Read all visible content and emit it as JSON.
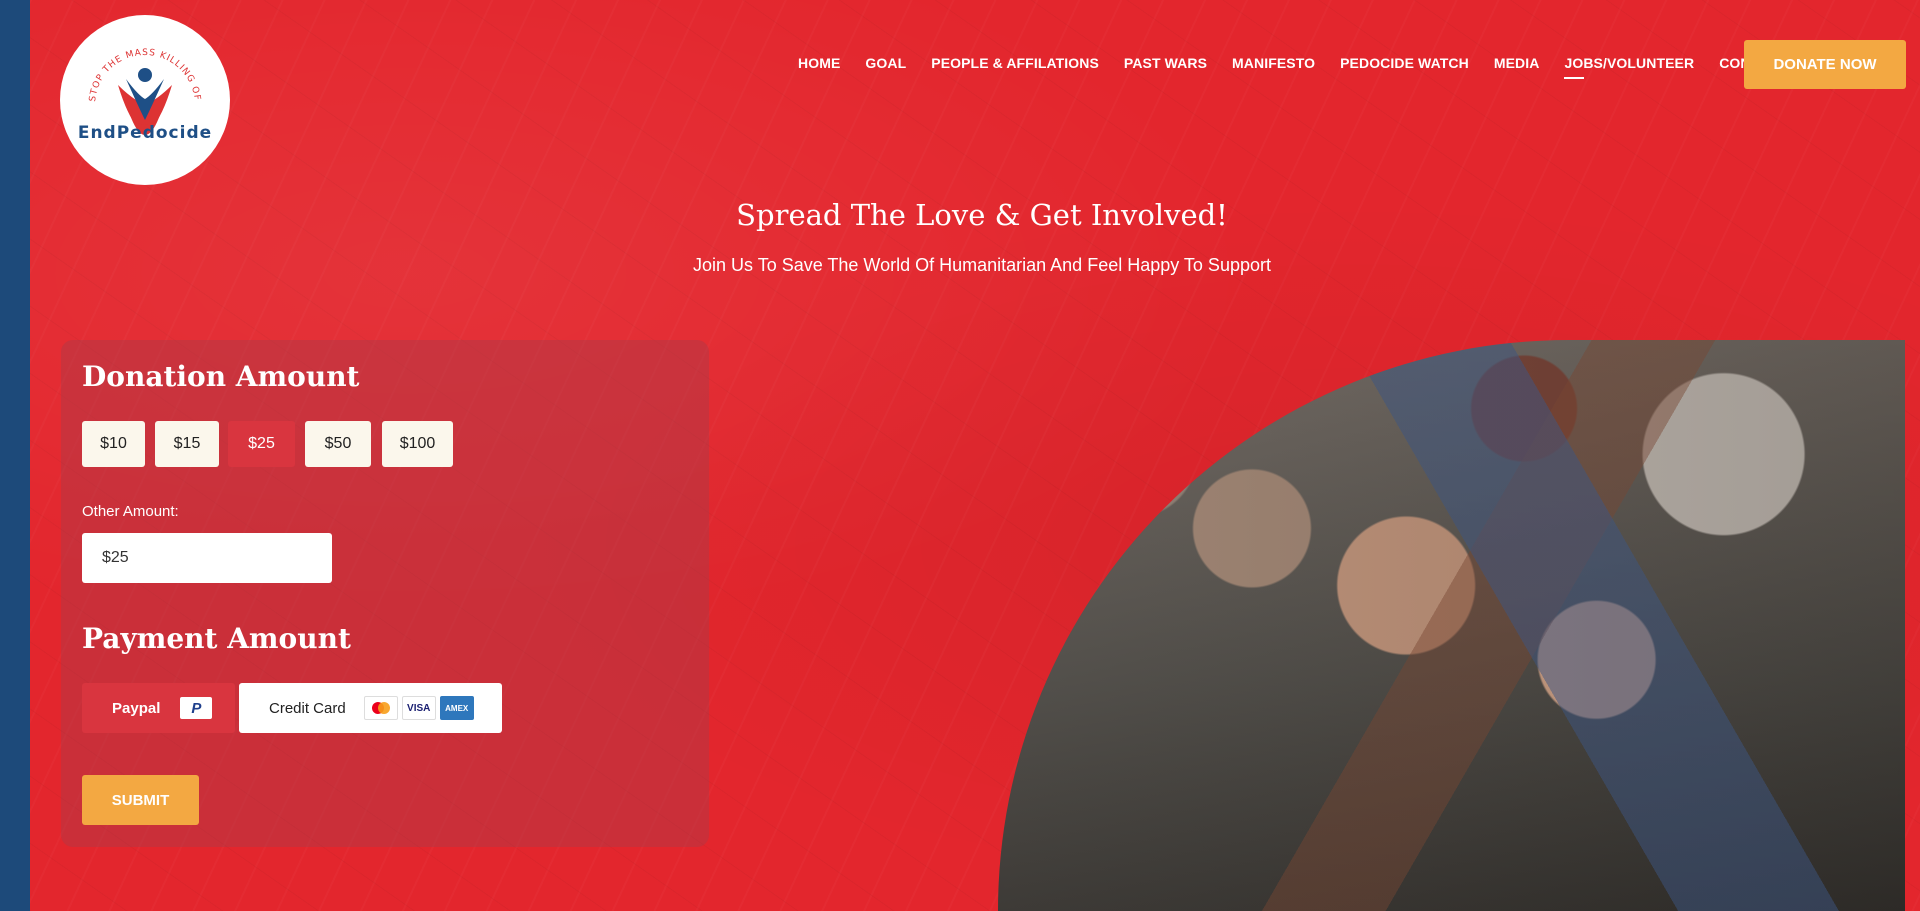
{
  "brand": {
    "logo_text": "EndPedocide",
    "logo_tagline": "STOP THE MASS KILLING OF CHILDREN"
  },
  "nav": [
    {
      "label": "HOME"
    },
    {
      "label": "GOAL"
    },
    {
      "label": "PEOPLE & AFFILATIONS"
    },
    {
      "label": "PAST WARS"
    },
    {
      "label": "MANIFESTO"
    },
    {
      "label": "PEDOCIDE WATCH"
    },
    {
      "label": "MEDIA"
    },
    {
      "label": "JOBS/VOLUNTEER",
      "active": true
    },
    {
      "label": "CONTACT"
    }
  ],
  "donate_button": "DONATE NOW",
  "hero": {
    "title": "Spread The Love & Get Involved!",
    "subtitle": "Join Us To Save The World Of Humanitarian And Feel Happy To Support"
  },
  "form": {
    "donation_heading": "Donation Amount",
    "amounts": [
      "$10",
      "$15",
      "$25",
      "$50",
      "$100"
    ],
    "selected_amount": "$25",
    "other_label": "Other Amount:",
    "other_value": "$25",
    "payment_heading": "Payment Amount",
    "paypal_label": "Paypal",
    "paypal_icon_text": "P",
    "card_label": "Credit Card",
    "card_brands": [
      "mastercard-icon",
      "VISA",
      "AMEX"
    ],
    "submit_label": "SUBMIT"
  },
  "colors": {
    "primary": "#e3262d",
    "accent": "#f3a842",
    "selected": "#d9353f",
    "strip": "#1d4a7a"
  }
}
